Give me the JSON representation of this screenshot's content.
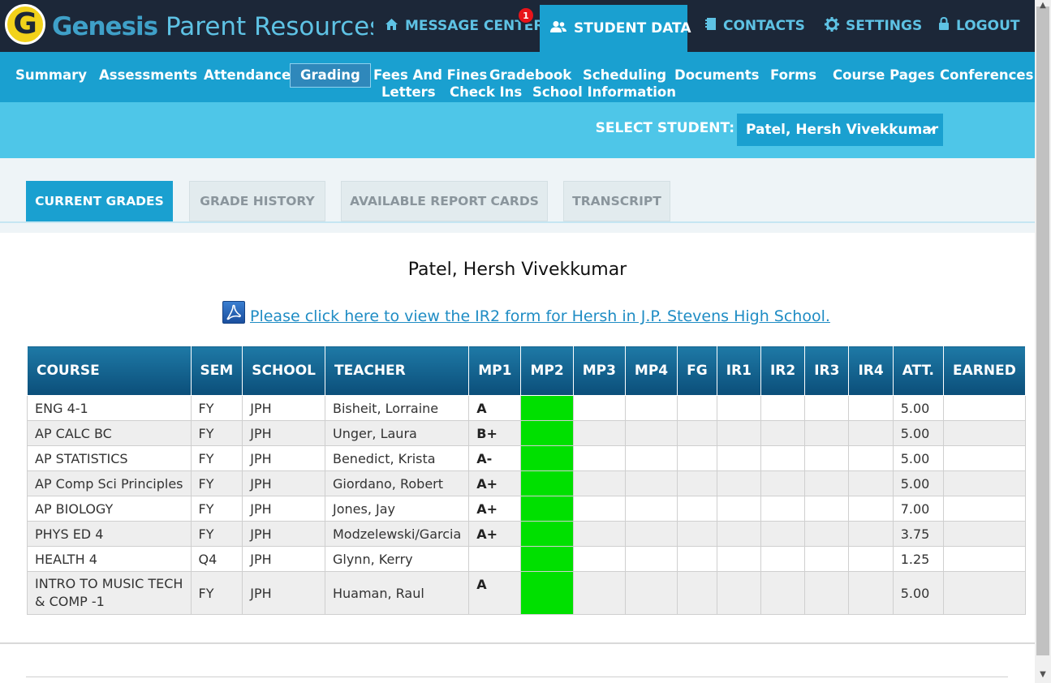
{
  "header": {
    "logo_letter": "G",
    "brand_bold": "Genesis",
    "brand_light": "Parent Resources",
    "nav": [
      {
        "label": "MESSAGE CENTER",
        "icon": "home-icon"
      },
      {
        "label": "STUDENT DATA",
        "icon": "users-icon"
      },
      {
        "label": "CONTACTS",
        "icon": "book-icon"
      },
      {
        "label": "SETTINGS",
        "icon": "gear-icon"
      },
      {
        "label": "LOGOUT",
        "icon": "lock-icon"
      }
    ],
    "message_badge": "1"
  },
  "subnav": {
    "items": [
      "Summary",
      "Assessments",
      "Attendance",
      "Grading",
      "Fees And Fines",
      "Gradebook",
      "Scheduling",
      "Documents",
      "Forms",
      "Course Pages",
      "Conferences",
      "Letters",
      "Check Ins",
      "School Information"
    ],
    "active": "Grading"
  },
  "select_student": {
    "label": "SELECT STUDENT:",
    "value": "Patel, Hersh Vivekkumar"
  },
  "tabs": [
    "CURRENT GRADES",
    "GRADE HISTORY",
    "AVAILABLE REPORT CARDS",
    "TRANSCRIPT"
  ],
  "main": {
    "student_name": "Patel, Hersh Vivekkumar",
    "ir2_link": "Please click here to view the IR2 form for Hersh in J.P. Stevens High School."
  },
  "grades": {
    "columns": [
      "COURSE",
      "SEM",
      "SCHOOL",
      "TEACHER",
      "MP1",
      "MP2",
      "MP3",
      "MP4",
      "FG",
      "IR1",
      "IR2",
      "IR3",
      "IR4",
      "ATT.",
      "EARNED"
    ],
    "rows": [
      {
        "course": "ENG 4-1",
        "sem": "FY",
        "school": "JPH",
        "teacher": "Bisheit, Lorraine",
        "mp1": "A",
        "att": "5.00"
      },
      {
        "course": "AP CALC BC",
        "sem": "FY",
        "school": "JPH",
        "teacher": "Unger, Laura",
        "mp1": "B+",
        "att": "5.00"
      },
      {
        "course": "AP STATISTICS",
        "sem": "FY",
        "school": "JPH",
        "teacher": "Benedict, Krista",
        "mp1": "A-",
        "att": "5.00"
      },
      {
        "course": "AP Comp Sci Principles",
        "sem": "FY",
        "school": "JPH",
        "teacher": "Giordano, Robert",
        "mp1": "A+",
        "att": "5.00"
      },
      {
        "course": "AP BIOLOGY",
        "sem": "FY",
        "school": "JPH",
        "teacher": "Jones, Jay",
        "mp1": "A+",
        "att": "7.00"
      },
      {
        "course": "PHYS ED 4",
        "sem": "FY",
        "school": "JPH",
        "teacher": "Modzelewski/Garcia",
        "mp1": "A+",
        "att": "3.75"
      },
      {
        "course": "HEALTH 4",
        "sem": "Q4",
        "school": "JPH",
        "teacher": "Glynn, Kerry",
        "mp1": "",
        "att": "1.25"
      },
      {
        "course": "INTRO TO MUSIC TECH & COMP -1",
        "sem": "FY",
        "school": "JPH",
        "teacher": "Huaman, Raul",
        "mp1": "A",
        "att": "5.00"
      }
    ],
    "mp2_highlight_color": "#00e000"
  },
  "colors": {
    "header_bg": "#1c2738",
    "accent": "#1aa0d0",
    "light_accent": "#4ec6e8",
    "table_header": "#0b4e79"
  }
}
